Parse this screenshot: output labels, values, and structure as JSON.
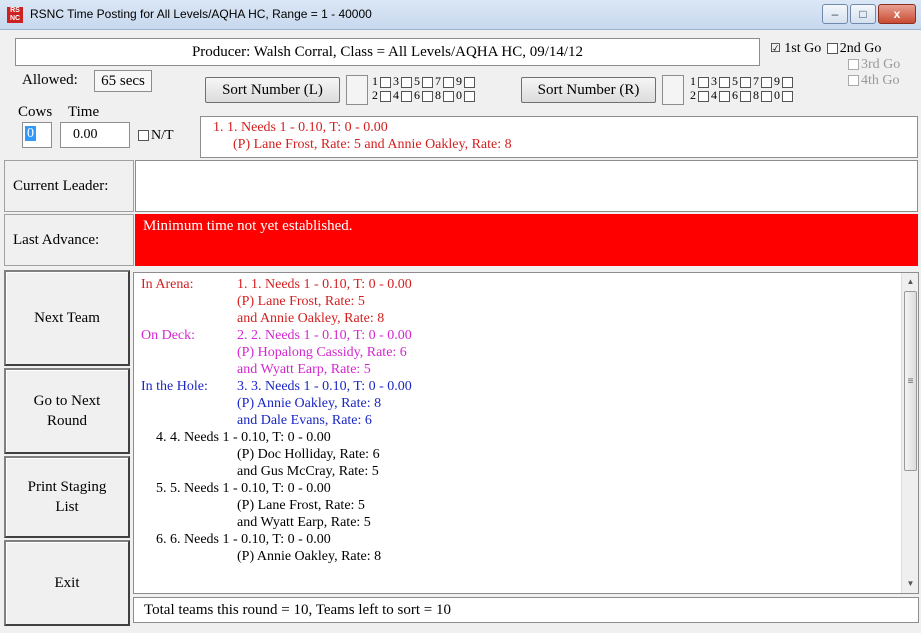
{
  "window": {
    "title": "RSNC Time Posting for All Levels/AQHA HC, Range = 1 - 40000",
    "icon_text": "RS NC",
    "minimize_glyph": "–",
    "maximize_glyph": "□",
    "close_glyph": "x"
  },
  "header": {
    "producer_line": "Producer: Walsh Corral, Class = All Levels/AQHA HC, 09/14/12",
    "go_options": [
      {
        "label": "1st Go",
        "checked": true,
        "enabled": true
      },
      {
        "label": "2nd Go",
        "checked": false,
        "enabled": true
      },
      {
        "label": "3rd Go",
        "checked": false,
        "enabled": false
      },
      {
        "label": "4th Go",
        "checked": false,
        "enabled": false
      }
    ],
    "checked_mark": "☑"
  },
  "allowed": {
    "label": "Allowed:",
    "value": "65 secs"
  },
  "sort": {
    "left_label": "Sort Number (L)",
    "right_label": "Sort Number (R)",
    "left_nums_top": [
      "1",
      "3",
      "5",
      "7",
      "9"
    ],
    "left_nums_bottom": [
      "2",
      "4",
      "6",
      "8",
      "0"
    ],
    "right_nums_top": [
      "1",
      "3",
      "5",
      "7",
      "9"
    ],
    "right_nums_bottom": [
      "2",
      "4",
      "6",
      "8",
      "0"
    ]
  },
  "entry": {
    "cows_label": "Cows",
    "time_label": "Time",
    "cows_value": "0",
    "time_value": "0.00",
    "nt_label": "N/T",
    "current_line1": "1.   1. Needs 1 - 0.10, T: 0 - 0.00",
    "current_line2": "(P) Lane Frost, Rate: 5 and Annie Oakley, Rate: 8"
  },
  "current_leader": {
    "label": "Current Leader:",
    "value": ""
  },
  "last_advance": {
    "label": "Last Advance:",
    "message": "Minimum time not yet established.",
    "bg_color": "#ff0000"
  },
  "buttons": {
    "next_team": "Next Team",
    "next_round_1": "Go to Next",
    "next_round_2": "Round",
    "print_1": "Print Staging",
    "print_2": "List",
    "exit": "Exit"
  },
  "staging": {
    "in_arena_label": "In Arena:",
    "on_deck_label": "On Deck:",
    "in_hole_label": "In the Hole:",
    "lines": [
      "1.   1. Needs 1 - 0.10, T: 0 - 0.00",
      "(P) Lane Frost, Rate: 5",
      "and Annie Oakley, Rate: 8",
      "2.   2. Needs 1 - 0.10, T: 0 - 0.00",
      "(P) Hopalong Cassidy, Rate: 6",
      "and Wyatt Earp, Rate: 5",
      "3.   3. Needs 1 - 0.10, T: 0 - 0.00",
      "(P) Annie Oakley, Rate: 8",
      "and Dale Evans, Rate: 6",
      "4.   4. Needs 1 - 0.10, T: 0 - 0.00",
      "(P) Doc Holliday, Rate: 6",
      "and Gus McCray, Rate: 5",
      "5.   5. Needs 1 - 0.10, T: 0 - 0.00",
      "(P) Lane Frost, Rate: 5",
      "and Wyatt Earp, Rate: 5",
      "6.   6. Needs 1 - 0.10, T: 0 - 0.00",
      "(P) Annie Oakley, Rate: 8"
    ],
    "scroll_up": "▲",
    "scroll_down": "▼",
    "scroll_grip": "≡"
  },
  "status": {
    "text": "Total teams this round = 10, Teams left to sort = 10"
  },
  "colors": {
    "in_arena": "#d41f1f",
    "on_deck": "#d327cf",
    "in_hole": "#1a27c4",
    "normal": "#222222"
  }
}
